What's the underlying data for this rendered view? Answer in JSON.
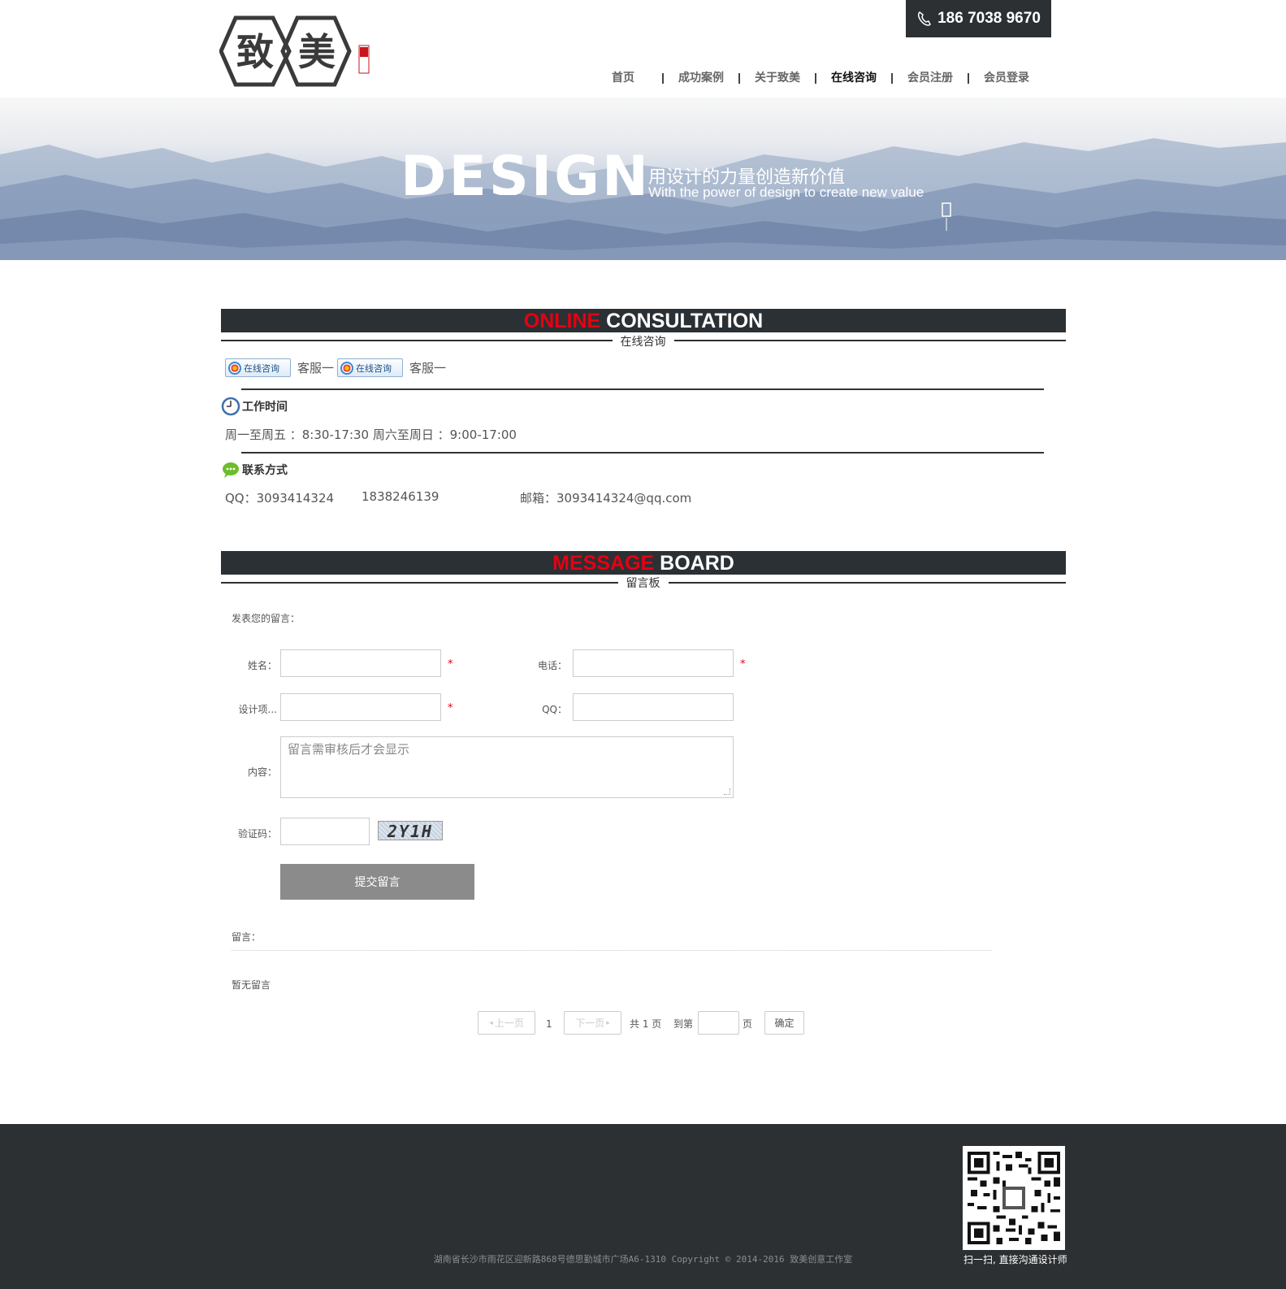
{
  "header": {
    "logo_text": "致美",
    "logo_seal_text": "创意",
    "phone": "186 7038 9670",
    "nav": [
      {
        "label": "首页",
        "active": false
      },
      {
        "label": "成功案例",
        "active": false
      },
      {
        "label": "关于致美",
        "active": false
      },
      {
        "label": "在线咨询",
        "active": true
      },
      {
        "label": "会员注册",
        "active": false
      },
      {
        "label": "会员登录",
        "active": false
      }
    ]
  },
  "banner": {
    "word": "DESIGN",
    "slogan_cn": "用设计的力量创造新价值",
    "slogan_en": "With the power of design to create new value"
  },
  "consult": {
    "title_red": "ONLINE",
    "title_white": " CONSULTATION",
    "subtitle": "在线咨询",
    "qq_buttons": [
      {
        "badge": "在线咨询",
        "label": "客服一"
      },
      {
        "badge": "在线咨询",
        "label": "客服一"
      }
    ],
    "work_time_title": "工作时间",
    "work_time": "周一至周五 ：8:30-17:30 周六至周日 ：9:00-17:00",
    "contact_title": "联系方式",
    "qq": "QQ：3093414324",
    "phone": "1838246139",
    "email": "邮箱：3093414324@qq.com"
  },
  "board": {
    "title_red": "MESSAGE",
    "title_white": " BOARD",
    "subtitle": "留言板",
    "intro": "发表您的留言：",
    "name_label": "姓名：",
    "phone_label": "电话：",
    "project_label": "设计项...",
    "qq_label": "QQ：",
    "content_label": "内容：",
    "content_placeholder": "留言需审核后才会显示",
    "captcha_label": "验证码：",
    "captcha_text": "2Y1H",
    "required_mark": "*",
    "submit_label": "提交留言",
    "messages_label": "留言：",
    "empty_text": "暂无留言",
    "pagination": {
      "prev": "上一页",
      "current": "1",
      "next": "下一页",
      "total": "共 1 页",
      "goto": "到第",
      "page_unit": "页",
      "confirm": "确定"
    }
  },
  "footer": {
    "copyright": "湖南省长沙市雨花区迎新路868号德思勤城市广场A6-1310  Copyright  ©  2014-2016  致美创意工作室",
    "qr_caption": "扫一扫, 直接沟通设计师"
  },
  "colors": {
    "dark": "#2c3033",
    "accent_red": "#e60012",
    "submit_gray": "#8b8b8b"
  }
}
